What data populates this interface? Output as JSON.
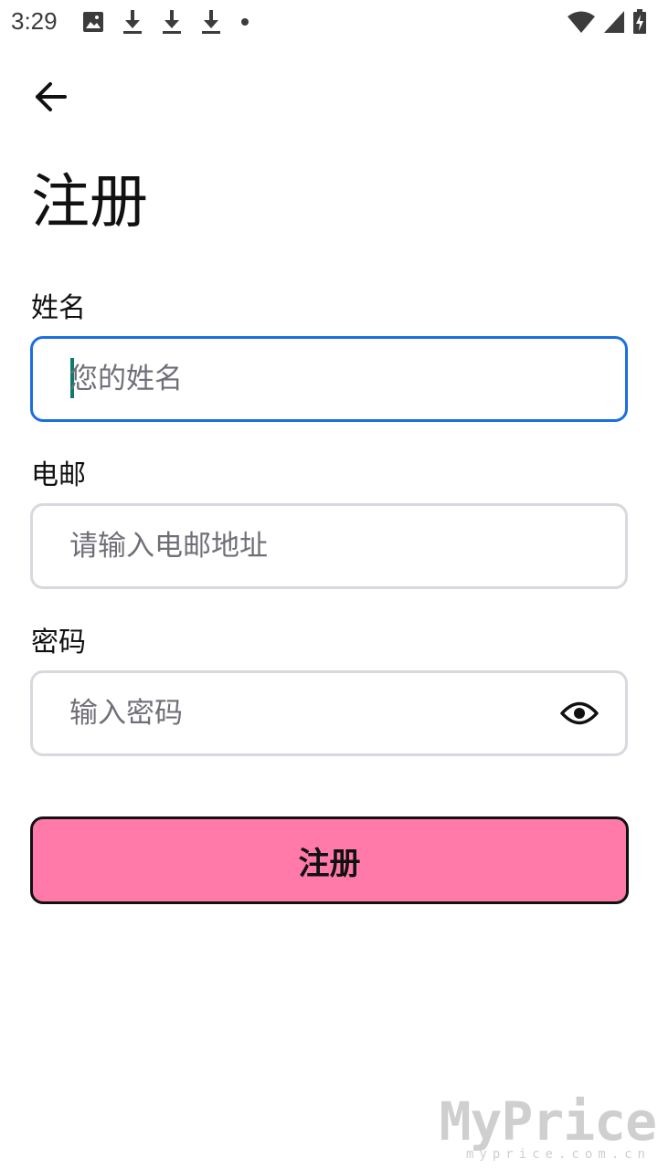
{
  "status_bar": {
    "time": "3:29",
    "left_icons": [
      "image-icon",
      "download-icon",
      "download-icon",
      "download-icon",
      "dot-icon"
    ],
    "right_icons": [
      "wifi-icon",
      "cellular-signal-icon",
      "battery-charging-icon"
    ]
  },
  "header": {
    "back_icon": "arrow-left-icon",
    "title": "注册"
  },
  "form": {
    "name": {
      "label": "姓名",
      "placeholder": "您的姓名",
      "value": ""
    },
    "email": {
      "label": "电邮",
      "placeholder": "请输入电邮地址",
      "value": ""
    },
    "password": {
      "label": "密码",
      "placeholder": "输入密码",
      "value": "",
      "toggle_icon": "eye-icon"
    },
    "submit_label": "注册"
  },
  "watermark": {
    "logo": "MyPrice",
    "sub": "myprice.com.cn"
  },
  "colors": {
    "focus_border": "#1a6fe0",
    "default_border": "#d8d8de",
    "button_bg": "#ff7aa8",
    "caret": "#0f7a6d"
  }
}
